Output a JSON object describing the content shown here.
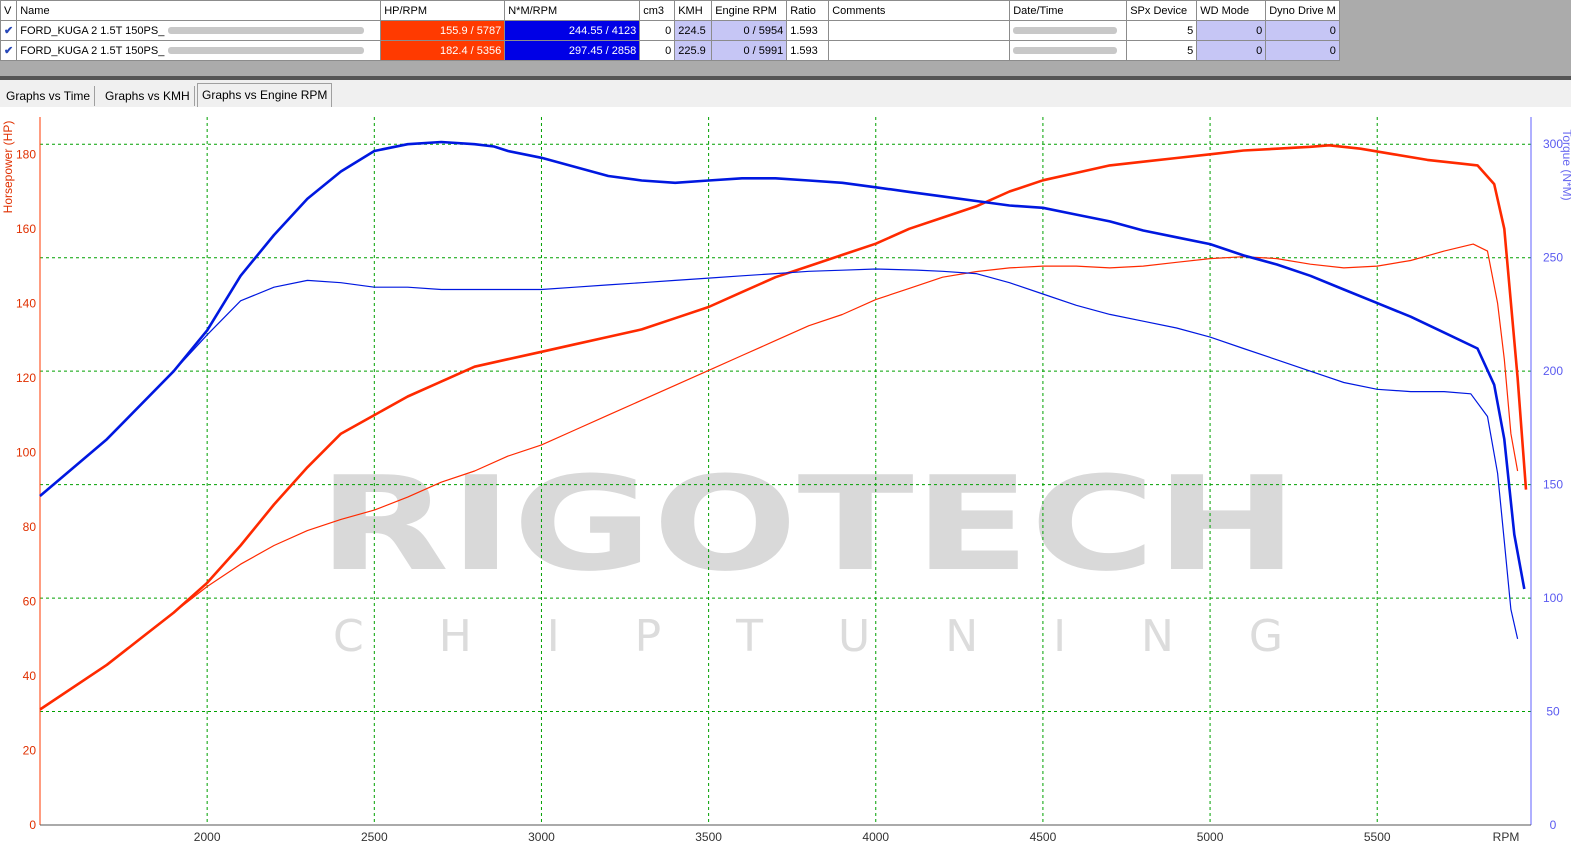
{
  "table": {
    "headers": [
      "V",
      "Name",
      "HP/RPM",
      "N*M/RPM",
      "cm3",
      "KMH",
      "Engine RPM",
      "Ratio",
      "Comments",
      "Date/Time",
      "SPx Device",
      "WD Mode",
      "Dyno Drive M"
    ],
    "rows": [
      {
        "name": "FORD_KUGA 2 1.5T 150PS_",
        "hp": "155.9 / 5787",
        "nm": "244.55 / 4123",
        "cm3": "0",
        "kmh": "224.5",
        "rpm": "0 / 5954",
        "ratio": "1.593",
        "spx": "5",
        "wd": "0",
        "drive": "0"
      },
      {
        "name": "FORD_KUGA 2 1.5T 150PS_",
        "hp": "182.4 / 5356",
        "nm": "297.45 / 2858",
        "cm3": "0",
        "kmh": "225.9",
        "rpm": "0 / 5991",
        "ratio": "1.593",
        "spx": "5",
        "wd": "0",
        "drive": "0"
      }
    ]
  },
  "tabs": [
    "Graphs vs Time",
    "Graphs vs KMH",
    "Graphs vs Engine RPM"
  ],
  "watermark": {
    "main": "RIGOTECH",
    "sub": "C H I P T U N I N G"
  },
  "colors": {
    "hp": "#ff2a00",
    "torque": "#0018e0",
    "grid": "#00a000",
    "hp_cell": "#ff3a00",
    "nm_cell": "#0000e6",
    "lavender": "#c6c6f5"
  },
  "chart_data": {
    "type": "line",
    "xlabel": "RPM",
    "ylabel_left": "Horsepower (HP)",
    "ylabel_right": "Torque (N*M)",
    "xlim": [
      1500,
      5960
    ],
    "ylim_left": [
      0,
      190
    ],
    "ylim_right": [
      0,
      312
    ],
    "x_ticks": [
      2000,
      2500,
      3000,
      3500,
      4000,
      4500,
      5000,
      5500
    ],
    "y_left_ticks": [
      0,
      20,
      40,
      60,
      80,
      100,
      120,
      140,
      160,
      180
    ],
    "y_right_ticks": [
      0,
      50,
      100,
      150,
      200,
      250,
      300
    ],
    "grid": true,
    "series": [
      {
        "axis": "left",
        "color": "#ff2a00",
        "width": 2.6,
        "points": [
          [
            1500,
            31
          ],
          [
            1700,
            43
          ],
          [
            1900,
            57
          ],
          [
            2000,
            65
          ],
          [
            2100,
            75
          ],
          [
            2200,
            86
          ],
          [
            2300,
            96
          ],
          [
            2400,
            105
          ],
          [
            2500,
            110
          ],
          [
            2600,
            115
          ],
          [
            2700,
            119
          ],
          [
            2800,
            123
          ],
          [
            2900,
            125
          ],
          [
            3000,
            127
          ],
          [
            3100,
            129
          ],
          [
            3200,
            131
          ],
          [
            3300,
            133
          ],
          [
            3400,
            136
          ],
          [
            3500,
            139
          ],
          [
            3600,
            143
          ],
          [
            3700,
            147
          ],
          [
            3800,
            150
          ],
          [
            3900,
            153
          ],
          [
            4000,
            156
          ],
          [
            4100,
            160
          ],
          [
            4200,
            163
          ],
          [
            4300,
            166
          ],
          [
            4400,
            170
          ],
          [
            4500,
            173
          ],
          [
            4600,
            175
          ],
          [
            4700,
            177
          ],
          [
            4800,
            178
          ],
          [
            4900,
            179
          ],
          [
            5000,
            180
          ],
          [
            5100,
            181
          ],
          [
            5200,
            181.5
          ],
          [
            5300,
            182
          ],
          [
            5356,
            182.4
          ],
          [
            5450,
            181.5
          ],
          [
            5550,
            180
          ],
          [
            5650,
            178.5
          ],
          [
            5750,
            177.5
          ],
          [
            5800,
            177
          ],
          [
            5850,
            172
          ],
          [
            5880,
            160
          ],
          [
            5920,
            120
          ],
          [
            5945,
            90
          ]
        ]
      },
      {
        "axis": "left",
        "color": "#ff2a00",
        "width": 1.2,
        "points": [
          [
            1500,
            31
          ],
          [
            1700,
            43
          ],
          [
            1900,
            57
          ],
          [
            2000,
            64
          ],
          [
            2100,
            70
          ],
          [
            2200,
            75
          ],
          [
            2300,
            79
          ],
          [
            2400,
            82
          ],
          [
            2500,
            84.5
          ],
          [
            2600,
            88
          ],
          [
            2700,
            92
          ],
          [
            2800,
            95
          ],
          [
            2900,
            99
          ],
          [
            3000,
            102
          ],
          [
            3100,
            106
          ],
          [
            3200,
            110
          ],
          [
            3300,
            114
          ],
          [
            3400,
            118
          ],
          [
            3500,
            122
          ],
          [
            3600,
            126
          ],
          [
            3700,
            130
          ],
          [
            3800,
            134
          ],
          [
            3900,
            137
          ],
          [
            4000,
            141
          ],
          [
            4100,
            144
          ],
          [
            4200,
            147
          ],
          [
            4300,
            148.5
          ],
          [
            4400,
            149.5
          ],
          [
            4500,
            150
          ],
          [
            4600,
            150
          ],
          [
            4700,
            149.5
          ],
          [
            4800,
            150
          ],
          [
            4900,
            151
          ],
          [
            5000,
            152
          ],
          [
            5100,
            152.5
          ],
          [
            5200,
            152
          ],
          [
            5300,
            150.5
          ],
          [
            5400,
            149.5
          ],
          [
            5500,
            150
          ],
          [
            5600,
            151.5
          ],
          [
            5700,
            154
          ],
          [
            5787,
            155.9
          ],
          [
            5830,
            154
          ],
          [
            5860,
            140
          ],
          [
            5880,
            125
          ],
          [
            5900,
            105
          ],
          [
            5920,
            95
          ]
        ]
      },
      {
        "axis": "right",
        "color": "#0018e0",
        "width": 2.6,
        "points": [
          [
            1500,
            145
          ],
          [
            1700,
            170
          ],
          [
            1900,
            200
          ],
          [
            2000,
            218
          ],
          [
            2100,
            242
          ],
          [
            2200,
            260
          ],
          [
            2300,
            276
          ],
          [
            2400,
            288
          ],
          [
            2500,
            297
          ],
          [
            2600,
            300
          ],
          [
            2700,
            301
          ],
          [
            2800,
            300
          ],
          [
            2858,
            299
          ],
          [
            2900,
            297
          ],
          [
            3000,
            294
          ],
          [
            3100,
            290
          ],
          [
            3200,
            286
          ],
          [
            3300,
            284
          ],
          [
            3400,
            283
          ],
          [
            3500,
            284
          ],
          [
            3600,
            285
          ],
          [
            3700,
            285
          ],
          [
            3800,
            284
          ],
          [
            3900,
            283
          ],
          [
            4000,
            281
          ],
          [
            4100,
            279
          ],
          [
            4200,
            277
          ],
          [
            4300,
            275
          ],
          [
            4400,
            273
          ],
          [
            4500,
            272
          ],
          [
            4600,
            269
          ],
          [
            4700,
            266
          ],
          [
            4800,
            262
          ],
          [
            4900,
            259
          ],
          [
            5000,
            256
          ],
          [
            5100,
            251
          ],
          [
            5200,
            247
          ],
          [
            5300,
            242
          ],
          [
            5400,
            236
          ],
          [
            5500,
            230
          ],
          [
            5600,
            224
          ],
          [
            5700,
            217
          ],
          [
            5800,
            210
          ],
          [
            5850,
            194
          ],
          [
            5880,
            170
          ],
          [
            5910,
            128
          ],
          [
            5940,
            104
          ]
        ]
      },
      {
        "axis": "right",
        "color": "#0018e0",
        "width": 1.2,
        "points": [
          [
            1500,
            145
          ],
          [
            1700,
            170
          ],
          [
            1900,
            200
          ],
          [
            2000,
            216
          ],
          [
            2100,
            231
          ],
          [
            2200,
            237
          ],
          [
            2300,
            240
          ],
          [
            2400,
            239
          ],
          [
            2500,
            237
          ],
          [
            2600,
            237
          ],
          [
            2700,
            236
          ],
          [
            2800,
            236
          ],
          [
            2900,
            236
          ],
          [
            3000,
            236
          ],
          [
            3100,
            237
          ],
          [
            3200,
            238
          ],
          [
            3300,
            239
          ],
          [
            3400,
            240
          ],
          [
            3500,
            241
          ],
          [
            3600,
            242
          ],
          [
            3700,
            243
          ],
          [
            3800,
            244
          ],
          [
            3900,
            244.5
          ],
          [
            4000,
            245
          ],
          [
            4123,
            244.55
          ],
          [
            4200,
            244
          ],
          [
            4300,
            243
          ],
          [
            4400,
            239
          ],
          [
            4500,
            234
          ],
          [
            4600,
            229
          ],
          [
            4700,
            225
          ],
          [
            4800,
            222
          ],
          [
            4900,
            219
          ],
          [
            5000,
            215
          ],
          [
            5100,
            210
          ],
          [
            5200,
            205
          ],
          [
            5300,
            200
          ],
          [
            5400,
            195
          ],
          [
            5500,
            192
          ],
          [
            5600,
            191
          ],
          [
            5700,
            191
          ],
          [
            5780,
            190
          ],
          [
            5830,
            180
          ],
          [
            5860,
            155
          ],
          [
            5880,
            125
          ],
          [
            5900,
            95
          ],
          [
            5920,
            82
          ]
        ]
      }
    ]
  }
}
